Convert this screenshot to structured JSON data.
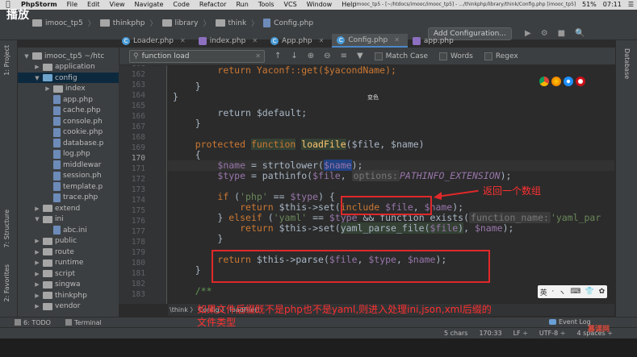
{
  "menubar": {
    "app": "PhpStorm",
    "items": [
      "File",
      "Edit",
      "View",
      "Navigate",
      "Code",
      "Refactor",
      "Run",
      "Tools",
      "VCS",
      "Window",
      "Help"
    ],
    "window_title": "imooc_tp5 - [~/htdocs/imooc/imooc_tp5] - .../thinkphp/library/think/Config.php [imooc_tp5]",
    "battery": "51%",
    "time": "07:11"
  },
  "overlay": {
    "play_label": "播放"
  },
  "breadcrumbs": [
    "imooc_tp5",
    "thinkphp",
    "library",
    "think",
    "Config.php"
  ],
  "toolbar": {
    "add_configuration": "Add Configuration...",
    "right_icons": [
      "▶",
      "⚙",
      "■",
      "🔍"
    ]
  },
  "tabs": [
    {
      "label": "Loader.php",
      "icon": "C",
      "active": false
    },
    {
      "label": "index.php",
      "icon": "P",
      "active": false
    },
    {
      "label": "App.php",
      "icon": "C",
      "active": false
    },
    {
      "label": "Config.php",
      "icon": "C",
      "active": true
    },
    {
      "label": "app.php",
      "icon": "P",
      "active": false
    }
  ],
  "left_tool_windows": {
    "project": "1: Project",
    "structure": "7: Structure",
    "favorites": "2: Favorites"
  },
  "right_tool_windows": {
    "database": "Database"
  },
  "project_tree": [
    {
      "label": "imooc_tp5  ~/htc",
      "type": "folder",
      "depth": 0,
      "expanded": true
    },
    {
      "label": "application",
      "type": "folder",
      "depth": 1,
      "expanded": false
    },
    {
      "label": "config",
      "type": "folder-blue",
      "depth": 1,
      "expanded": true,
      "selected": true
    },
    {
      "label": "index",
      "type": "folder",
      "depth": 2
    },
    {
      "label": "app.php",
      "type": "file",
      "depth": 2
    },
    {
      "label": "cache.php",
      "type": "file",
      "depth": 2
    },
    {
      "label": "console.ph",
      "type": "file",
      "depth": 2
    },
    {
      "label": "cookie.php",
      "type": "file",
      "depth": 2
    },
    {
      "label": "database.p",
      "type": "file",
      "depth": 2
    },
    {
      "label": "log.php",
      "type": "file",
      "depth": 2
    },
    {
      "label": "middlewar",
      "type": "file",
      "depth": 2
    },
    {
      "label": "session.ph",
      "type": "file",
      "depth": 2
    },
    {
      "label": "template.p",
      "type": "file",
      "depth": 2
    },
    {
      "label": "trace.php",
      "type": "file",
      "depth": 2
    },
    {
      "label": "extend",
      "type": "folder",
      "depth": 1
    },
    {
      "label": "ini",
      "type": "folder",
      "depth": 1,
      "expanded": true
    },
    {
      "label": "abc.ini",
      "type": "file",
      "depth": 2
    },
    {
      "label": "public",
      "type": "folder",
      "depth": 1
    },
    {
      "label": "route",
      "type": "folder",
      "depth": 1
    },
    {
      "label": "runtime",
      "type": "folder",
      "depth": 1
    },
    {
      "label": "script",
      "type": "folder",
      "depth": 1
    },
    {
      "label": "singwa",
      "type": "folder",
      "depth": 1
    },
    {
      "label": "thinkphp",
      "type": "folder",
      "depth": 1
    },
    {
      "label": "vendor",
      "type": "folder",
      "depth": 1
    }
  ],
  "search": {
    "value": "function load",
    "options": [
      "Match Case",
      "Words",
      "Regex"
    ]
  },
  "line_numbers": [
    "161",
    "162",
    "163",
    "164",
    "165",
    "166",
    "167",
    "168",
    "169",
    "170",
    "171",
    "172",
    "173",
    "174",
    "175",
    "176",
    "177",
    "178",
    "179",
    "180",
    "181",
    "182",
    "183"
  ],
  "code": {
    "l161": "return Yaconf::get($yacondName);",
    "l165": "return $default;",
    "l168_a": "protected",
    "l168_b": "function",
    "l168_c": "loadFile",
    "l168_d": "($file, $name)",
    "l170_a": "$name",
    "l170_b": " = strtolower(",
    "l170_c": "$name",
    "l170_d": ");",
    "l171_a": "$type",
    "l171_b": " = pathinfo(",
    "l171_c": "$file",
    "l171_d": ", ",
    "l171_hint": "options:",
    "l171_const": "PATHINFO_EXTENSION",
    "l171_e": ");",
    "l173_a": "if",
    "l173_b": " (",
    "l173_c": "'php'",
    "l173_d": " == ",
    "l173_e": "$type",
    "l173_f": ") {",
    "l174_a": "return",
    "l174_b": " $this->set(",
    "l174_c": "include",
    "l174_d": " $file",
    "l174_e": ", ",
    "l174_f": "$name",
    "l174_g": ");",
    "l175_a": "} ",
    "l175_b": "elseif",
    "l175_c": " (",
    "l175_d": "'yaml'",
    "l175_e": " == ",
    "l175_f": "$type",
    "l175_g": " && function_exists(",
    "l175_hint": "function_name:",
    "l175_h": "'yaml_par",
    "l176_a": "return",
    "l176_b": " $this->set(",
    "l176_c": "yaml_parse_file(",
    "l176_d": "$file",
    "l176_e": ")",
    "l176_f": ", ",
    "l176_g": "$name",
    "l176_h": ");",
    "l179_a": "return",
    "l179_b": " $this->parse(",
    "l179_c": "$file",
    "l179_d": ", ",
    "l179_e": "$type",
    "l179_f": ", ",
    "l179_g": "$name",
    "l179_h": ");",
    "l182": "/**"
  },
  "annotations": {
    "returns_array": "返回一个数组",
    "note_line1": "如果文件后缀既不是php也不是yaml,则进入处理ini,json,xml后缀的",
    "note_line2": "文件类型",
    "small_mark": "变色"
  },
  "editor_breadcrumb": "\\think  〉 Config  〉 loadFile()",
  "tool_window_bar": {
    "todo": "6: TODO",
    "terminal": "Terminal",
    "event_log": "Event Log"
  },
  "status": {
    "chars": "5 chars",
    "position": "170:33",
    "line_sep": "LF ÷",
    "encoding": "UTF-8 ÷",
    "indent": "4 spaces ÷"
  },
  "ime": {
    "items": [
      "英",
      "·",
      "ヽ",
      "⌨",
      "👕",
      "✿"
    ]
  },
  "watermark": "慕课网",
  "colors": {
    "keyword": "#cc7832",
    "variable": "#9876aa",
    "function": "#ffc66d",
    "string": "#6a8759",
    "annotation_red": "#e0282a"
  }
}
